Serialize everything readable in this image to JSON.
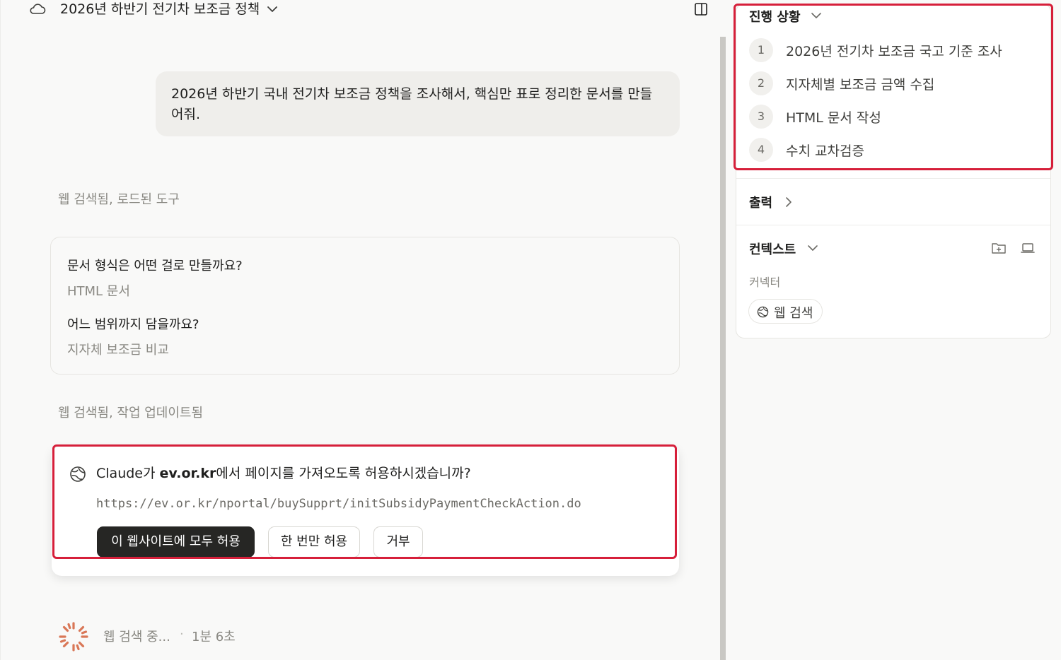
{
  "header": {
    "title": "2026년 하반기 전기차 보조금 정책",
    "icons": {
      "left": "cloud-icon",
      "dropdown": "chevron-down-icon",
      "right": "panel-toggle-icon"
    }
  },
  "chat": {
    "user_message": "2026년 하반기 국내 전기차 보조금 정책을 조사해서, 핵심만 표로 정리한 문서를 만들어줘.",
    "status_1": "웹 검색됨, 로드된 도구",
    "qa": [
      {
        "question": "문서 형식은 어떤 걸로 만들까요?",
        "answer": "HTML 문서"
      },
      {
        "question": "어느 범위까지 담을까요?",
        "answer": "지자체 보조금 비교"
      }
    ],
    "status_2": "웹 검색됨, 작업 업데이트됨",
    "permission": {
      "prefix": "Claude가 ",
      "domain": "ev.or.kr",
      "suffix": "에서 페이지를 가져오도록 허용하시겠습니까?",
      "url": "https://ev.or.kr/nportal/buySupprt/initSubsidyPaymentCheckAction.do",
      "allow_all_label": "이 웹사이트에 모두 허용",
      "allow_once_label": "한 번만 허용",
      "deny_label": "거부"
    },
    "footer": {
      "searching": "웹 검색 중...",
      "separator": "·",
      "elapsed": "1분 6초"
    }
  },
  "sidebar": {
    "progress": {
      "title": "진행 상황",
      "steps": [
        {
          "num": "1",
          "label": "2026년 전기차 보조금 국고 기준 조사"
        },
        {
          "num": "2",
          "label": "지자체별 보조금 금액 수집"
        },
        {
          "num": "3",
          "label": "HTML 문서 작성"
        },
        {
          "num": "4",
          "label": "수치 교차검증"
        }
      ]
    },
    "output": {
      "title": "출력"
    },
    "context": {
      "title": "컨텍스트",
      "connector_label": "커넥터",
      "chip_label": "웹 검색"
    }
  },
  "colors": {
    "highlight": "#d61f3a",
    "primary_button": "#262624",
    "muted_text": "#8a8983",
    "spinner": "#d97757"
  }
}
